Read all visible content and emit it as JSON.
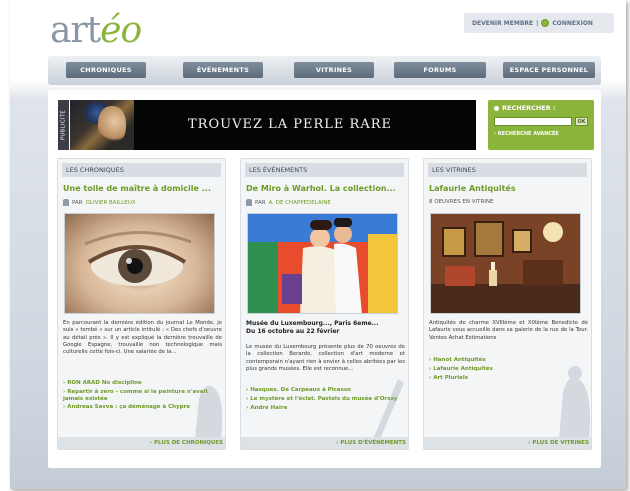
{
  "logo": {
    "text_main": "art",
    "text_accent": "éo"
  },
  "topbar": {
    "member_label": "DEVENIR MEMBRE",
    "separator": "|",
    "login_label": "CONNEXION"
  },
  "nav": {
    "items": [
      {
        "label": "CHRONIQUES"
      },
      {
        "label": "ÉVÉNEMENTS"
      },
      {
        "label": "VITRINES"
      },
      {
        "label": "FORUMS"
      },
      {
        "label": "ESPACE PERSONNEL"
      }
    ]
  },
  "banner": {
    "pub_label": "PUBLICITÉ",
    "headline": "TROUVEZ LA PERLE RARE"
  },
  "search": {
    "title": "RECHERCHER :",
    "placeholder": "",
    "ok_label": "OK",
    "advanced_label": "› RECHERCHE AVANCÉE"
  },
  "columns": [
    {
      "header": "LES CHRONIQUES",
      "title": "Une toile de maître à domicile ...",
      "meta_prefix": "PAR",
      "author": "OLIVIER BAILLEUX",
      "text": "En parcourant la dernière édition du journal Le Monde, je suis « tombé » sur un article intitulé : « Des chefs d'oeuvre au détail près ». Il y est expliqué la dernière trouvaille de Google Espagne, trouvaille non technologique mais culturelle cette fois-ci. Une salariée de la...",
      "links": [
        "RON ARAD No discipline",
        "Repartir à zéro - comme si la peinture n'avait jamais existée",
        "Andreas Savva : ça déménage à Chypre"
      ],
      "footer": "› PLUS DE CHRONIQUES"
    },
    {
      "header": "LES ÉVÉNEMENTS",
      "title": "De Miro à Warhol. La collection...",
      "meta_prefix": "PAR",
      "author": "A. DE CHAPPEDELAINE",
      "caption_line1": "Musée du Luxembourg..., Paris 6eme...",
      "caption_line2": "Du 16 octobre au 22 février",
      "text": "Le musée du Luxembourg présente plus de 70 oeuvres de la collection Berardo, collection d'art moderne et contemporain n'ayant rien à envier à celles abritées par les plus grands musées. Elle est reconnue...",
      "links": [
        "Hasques. De Carpeaux à Picasso",
        "Le mystère et l'éclat. Pastels du musée d'Orsay",
        "André Haire"
      ],
      "footer": "› PLUS D'ÉVÉNEMENTS"
    },
    {
      "header": "LES VITRINES",
      "title": "Lafaurie Antiquités",
      "meta_text": "8 OEUVRES EN VITRINE",
      "text": "Antiquités de charme XVIIIème et XIXème Benedicte de Lafaurie vous accueille dans sa galerie de la rue de la Tour. Ventes Achat Estimations",
      "links": [
        "Hanot Antiquités",
        "Lafaurie Antiquités",
        "Art Pluriels"
      ],
      "footer": "› PLUS DE VITRINES"
    }
  ],
  "colors": {
    "accent_green": "#8ab43b",
    "nav_gray": "#6b7a8a",
    "text_dark": "#333333"
  }
}
